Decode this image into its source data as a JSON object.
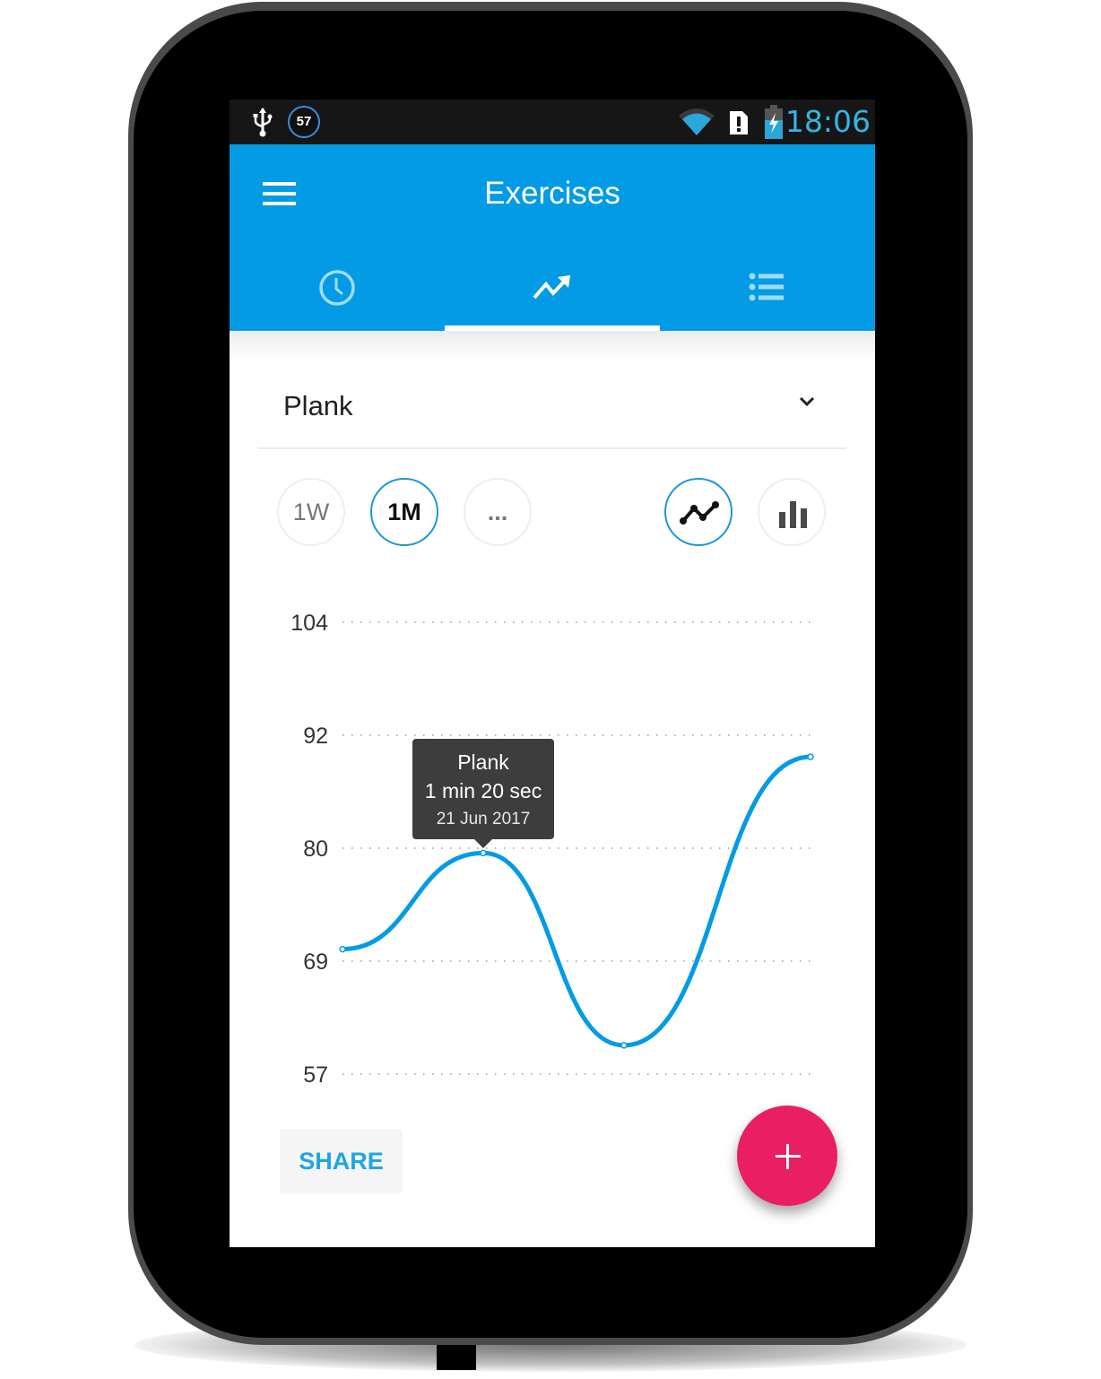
{
  "status_bar": {
    "notification_count": "57",
    "time": "18:06",
    "icons": [
      "usb-icon",
      "notification-badge",
      "wifi-icon",
      "sim-alert-icon",
      "battery-charging-icon"
    ],
    "time_color": "#33b5e5"
  },
  "app_bar": {
    "title": "Exercises",
    "menu_icon": "hamburger-menu-icon",
    "color": "#039be5",
    "tabs": [
      {
        "name": "history",
        "icon": "clock-icon",
        "active": false
      },
      {
        "name": "progress",
        "icon": "trending-up-icon",
        "active": true
      },
      {
        "name": "list",
        "icon": "list-icon",
        "active": false
      }
    ]
  },
  "exercise_selector": {
    "value": "Plank",
    "icon": "chevron-down-icon"
  },
  "range_options": [
    {
      "label": "1W",
      "active": false
    },
    {
      "label": "1M",
      "active": true
    },
    {
      "label": "...",
      "active": false
    }
  ],
  "chart_type_options": [
    {
      "type": "line",
      "icon": "line-chart-icon",
      "active": true
    },
    {
      "type": "bar",
      "icon": "bar-chart-icon",
      "active": false
    }
  ],
  "tooltip": {
    "title": "Plank",
    "value": "1 min 20 sec",
    "date": "21 Jun 2017"
  },
  "actions": {
    "share_label": "SHARE",
    "fab_icon": "plus-icon",
    "fab_color": "#e91e63"
  },
  "chart_data": {
    "type": "line",
    "title": "",
    "xlabel": "",
    "ylabel": "",
    "y_ticks": [
      "104",
      "92",
      "80",
      "69",
      "57"
    ],
    "ylim": [
      57,
      104
    ],
    "grid": true,
    "smooth": true,
    "series": [
      {
        "name": "Plank",
        "color": "#039be5",
        "values": [
          70,
          80,
          60,
          90
        ]
      }
    ],
    "highlighted_point": {
      "index": 1,
      "value": 80,
      "label": "1 min 20 sec",
      "date": "21 Jun 2017"
    }
  }
}
